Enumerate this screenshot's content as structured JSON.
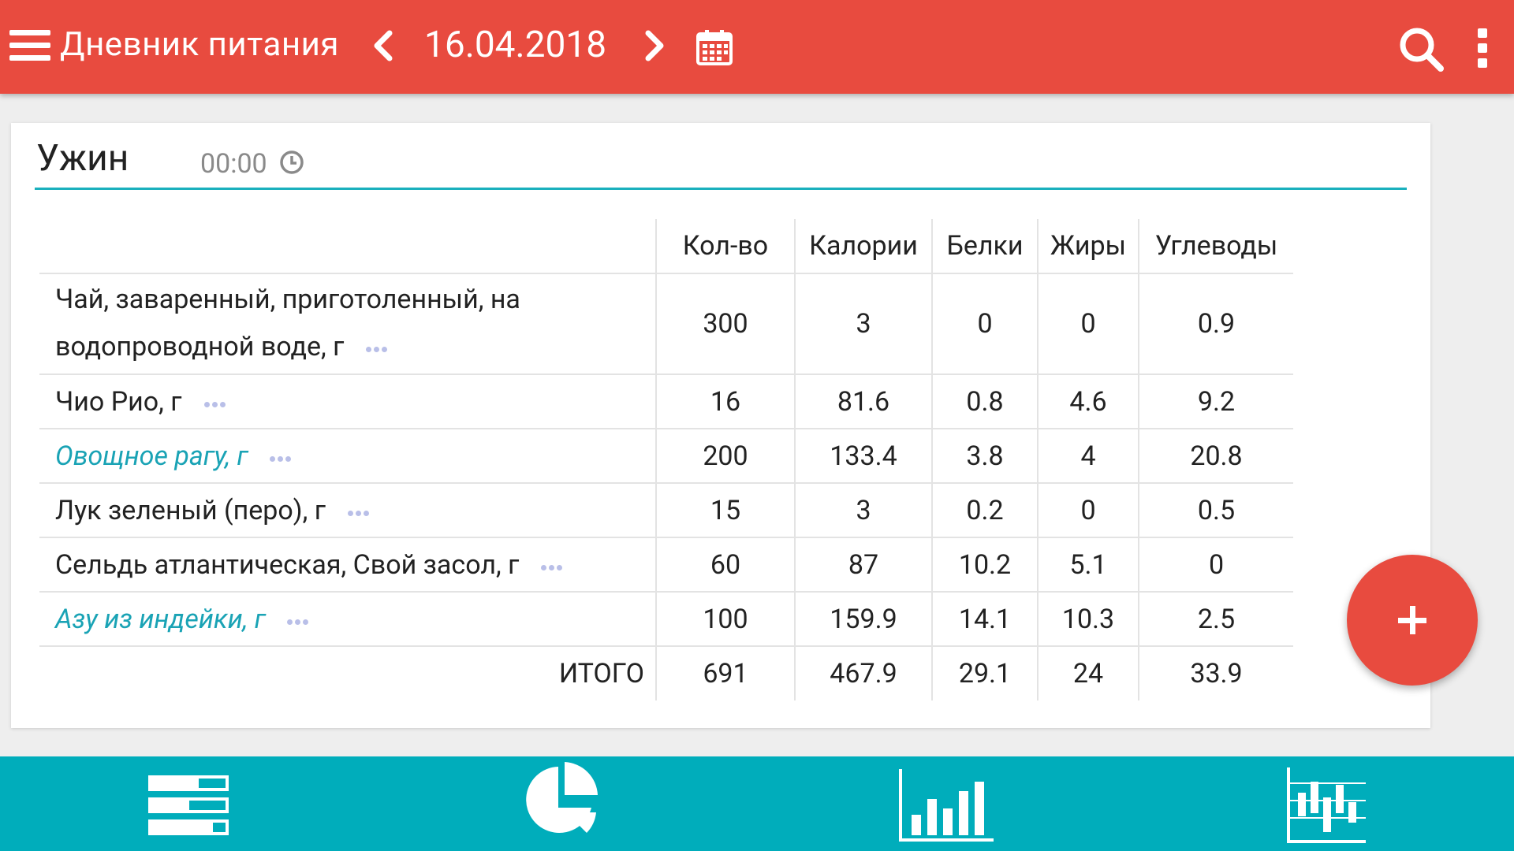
{
  "header": {
    "title": "Дневник питания",
    "date": "16.04.2018",
    "icons": [
      "menu-icon",
      "chevron-left-icon",
      "chevron-right-icon",
      "calendar-icon",
      "search-icon",
      "more-vert-icon"
    ]
  },
  "meal": {
    "title": "Ужин",
    "time": "00:00"
  },
  "table": {
    "columns": [
      "Кол-во",
      "Калории",
      "Белки",
      "Жиры",
      "Углеводы"
    ],
    "rows": [
      {
        "name_line1": "Чай, заваренный, приготоленный, на",
        "name_line2": "водопроводной воде, г",
        "qty": "300",
        "cal": "3",
        "protein": "0",
        "fat": "0",
        "carbs": "0.9"
      },
      {
        "name": "Чио Рио, г",
        "qty": "16",
        "cal": "81.6",
        "protein": "0.8",
        "fat": "4.6",
        "carbs": "9.2"
      },
      {
        "name": "Овощное рагу, г",
        "qty": "200",
        "cal": "133.4",
        "protein": "3.8",
        "fat": "4",
        "carbs": "20.8"
      },
      {
        "name": "Лук зеленый (перо), г",
        "qty": "15",
        "cal": "3",
        "protein": "0.2",
        "fat": "0",
        "carbs": "0.5"
      },
      {
        "name": "Сельдь атлантическая, Свой засол, г",
        "qty": "60",
        "cal": "87",
        "protein": "10.2",
        "fat": "5.1",
        "carbs": "0"
      },
      {
        "name": "Азу из индейки, г",
        "qty": "100",
        "cal": "159.9",
        "protein": "14.1",
        "fat": "10.3",
        "carbs": "2.5"
      }
    ],
    "total": {
      "label": "ИТОГО",
      "qty": "691",
      "cal": "467.9",
      "protein": "29.1",
      "fat": "24",
      "carbs": "33.9"
    }
  },
  "colors": {
    "header": "#e84b3f",
    "accent": "#00adbb",
    "link": "#1aa3b5",
    "fab": "#e84b3f"
  },
  "bottom_nav": {
    "icons": [
      "diary-list-icon",
      "pie-chart-icon",
      "bar-chart-icon",
      "statistics-chart-icon"
    ]
  }
}
